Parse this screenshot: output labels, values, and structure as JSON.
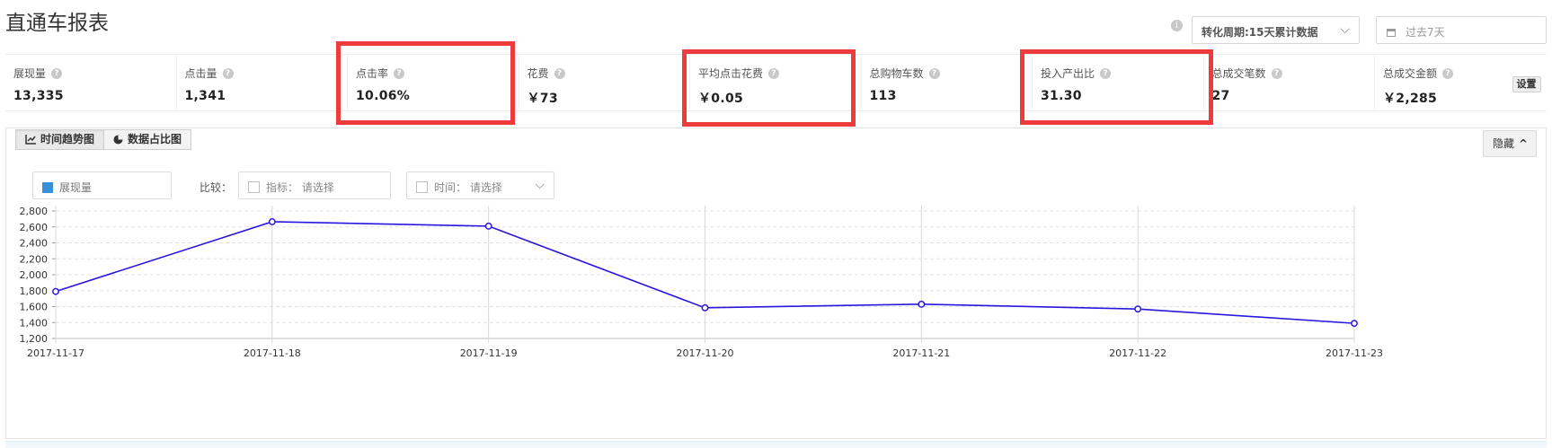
{
  "header": {
    "title": "直通车报表",
    "period_label": "转化周期:15天累计数据",
    "date_placeholder": "过去7天"
  },
  "metrics": [
    {
      "label": "展现量",
      "value": "13,335",
      "highlighted": false
    },
    {
      "label": "点击量",
      "value": "1,341",
      "highlighted": false
    },
    {
      "label": "点击率",
      "value": "10.06%",
      "highlighted": true
    },
    {
      "label": "花费",
      "value": "￥73",
      "highlighted": false
    },
    {
      "label": "平均点击花费",
      "value": "￥0.05",
      "highlighted": true
    },
    {
      "label": "总购物车数",
      "value": "113",
      "highlighted": false
    },
    {
      "label": "投入产出比",
      "value": "31.30",
      "highlighted": true
    },
    {
      "label": "总成交笔数",
      "value": "27",
      "highlighted": false
    },
    {
      "label": "总成交金额",
      "value": "￥2,285",
      "highlighted": false
    }
  ],
  "settings_label": "设置",
  "tabs": {
    "trend": "时间趋势图",
    "share": "数据占比图"
  },
  "hide_label": "隐藏",
  "controls": {
    "series_label": "展现量",
    "compare_label": "比较：",
    "metric_filter": "指标： 请选择",
    "time_filter": "时间： 请选择"
  },
  "colors": {
    "series": "#2a16e0",
    "highlight": "#ef3b3b",
    "series_swatch": "#3a8fd9"
  },
  "chart_data": {
    "type": "line",
    "x": [
      "2017-11-17",
      "2017-11-18",
      "2017-11-19",
      "2017-11-20",
      "2017-11-21",
      "2017-11-22",
      "2017-11-23"
    ],
    "series": [
      {
        "name": "展现量",
        "values": [
          1790,
          2665,
          2610,
          1585,
          1630,
          1570,
          1390
        ]
      }
    ],
    "ylim": [
      1200,
      2800
    ],
    "yticks": [
      "1,200",
      "1,400",
      "1,600",
      "1,800",
      "2,000",
      "2,200",
      "2,400",
      "2,600",
      "2,800"
    ],
    "grid": true
  }
}
